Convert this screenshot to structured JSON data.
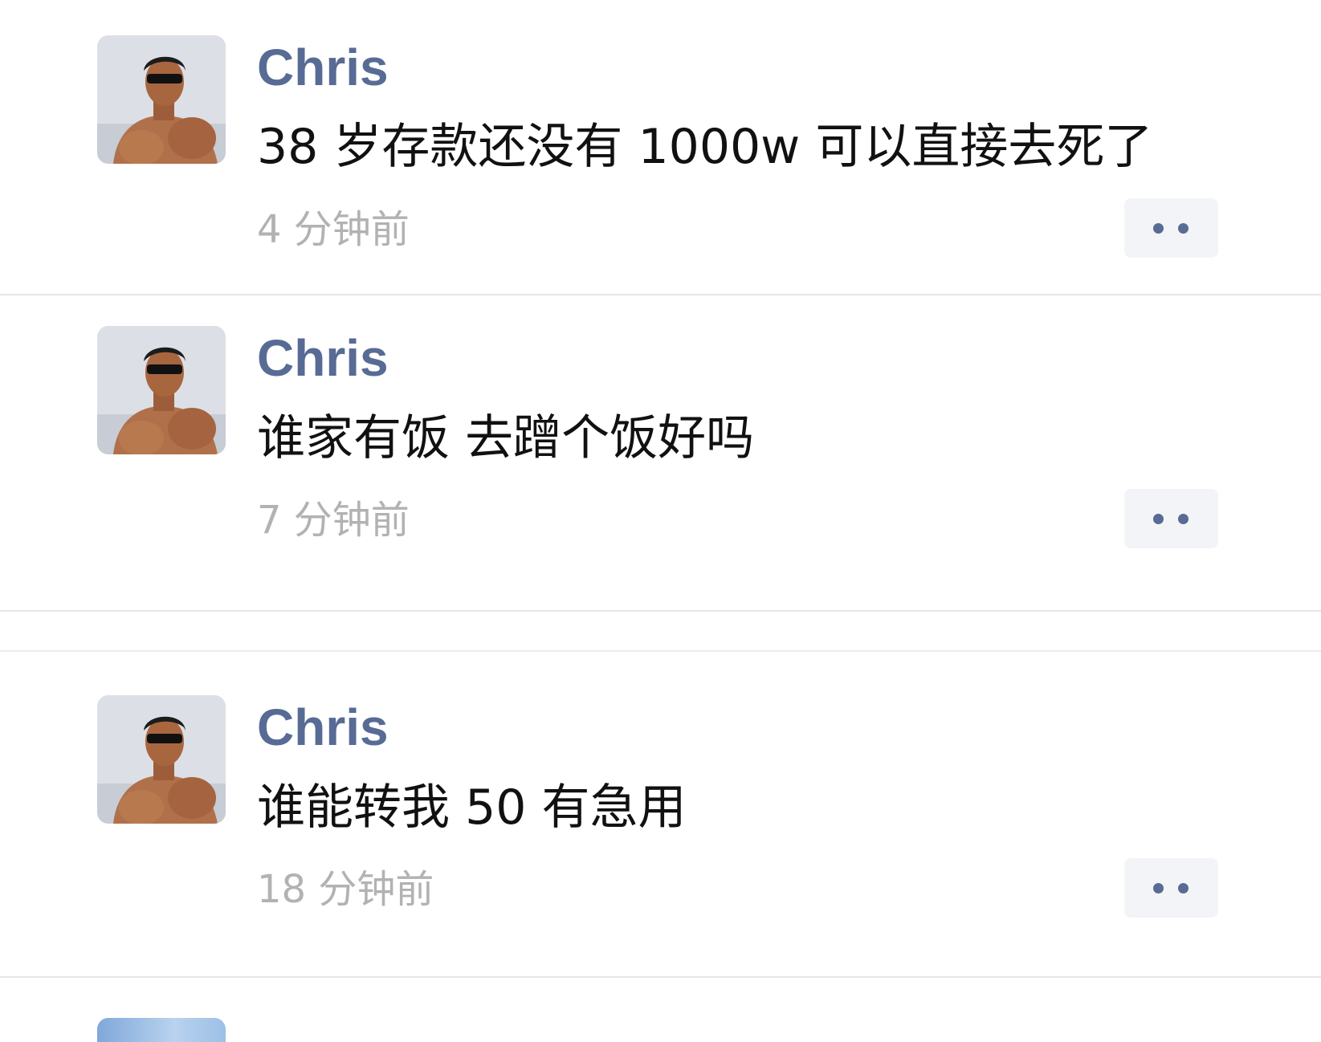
{
  "posts": [
    {
      "author": "Chris",
      "content": "38 岁存款还没有 1000w 可以直接去死了",
      "time": "4 分钟前",
      "avatar_icon": "avatar-muscular-man-sunglasses"
    },
    {
      "author": "Chris",
      "content": "谁家有饭 去蹭个饭好吗",
      "time": "7 分钟前",
      "avatar_icon": "avatar-muscular-man-sunglasses"
    },
    {
      "author": "Chris",
      "content": "谁能转我 50  有急用",
      "time": "18 分钟前",
      "avatar_icon": "avatar-muscular-man-sunglasses"
    }
  ],
  "colors": {
    "author": "#576b95",
    "content": "#111111",
    "time": "#b2b2b2",
    "more_button_bg": "#f3f4f7",
    "divider": "#e5e5e5"
  },
  "icons": {
    "more": "two-dots-more-icon"
  }
}
